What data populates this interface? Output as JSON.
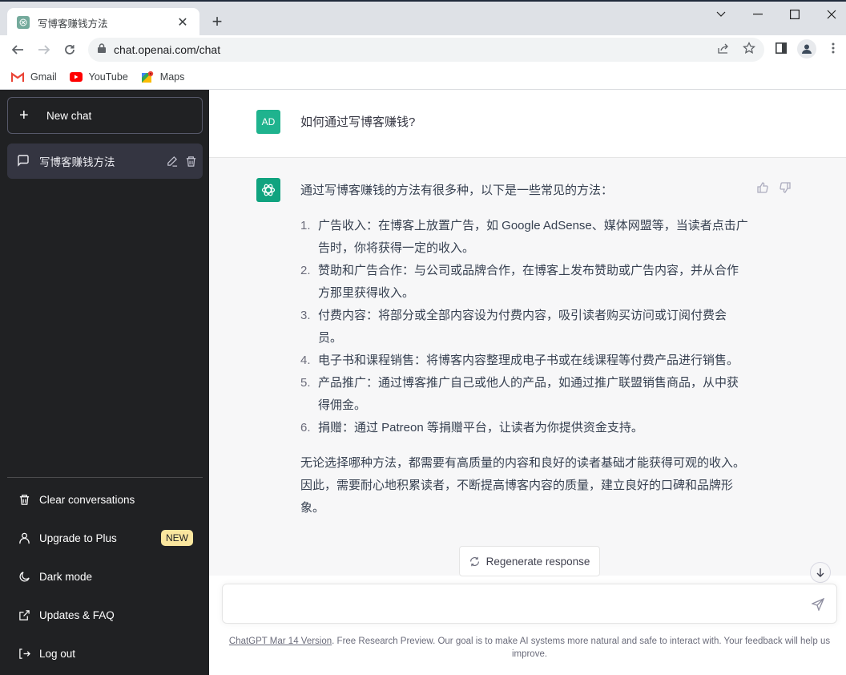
{
  "browser": {
    "tab_title": "写博客赚钱方法",
    "url": "chat.openai.com/chat",
    "bookmarks": [
      {
        "label": "Gmail",
        "icon": "gmail-icon"
      },
      {
        "label": "YouTube",
        "icon": "youtube-icon"
      },
      {
        "label": "Maps",
        "icon": "maps-icon"
      }
    ]
  },
  "sidebar": {
    "new_chat_label": "New chat",
    "conversation_title": "写博客赚钱方法",
    "items": [
      {
        "label": "Clear conversations",
        "icon": "trash-icon"
      },
      {
        "label": "Upgrade to Plus",
        "icon": "user-icon",
        "badge": "NEW"
      },
      {
        "label": "Dark mode",
        "icon": "moon-icon"
      },
      {
        "label": "Updates & FAQ",
        "icon": "external-link-icon"
      },
      {
        "label": "Log out",
        "icon": "logout-icon"
      }
    ]
  },
  "chat": {
    "user_avatar": "AD",
    "user_message": "如何通过写博客赚钱?",
    "bot_intro": "通过写博客赚钱的方法有很多种，以下是一些常见的方法：",
    "bot_list": [
      {
        "num": "1.",
        "text": "广告收入：在博客上放置广告，如 Google AdSense、媒体网盟等，当读者点击广告时，你将获得一定的收入。"
      },
      {
        "num": "2.",
        "text": "赞助和广告合作：与公司或品牌合作，在博客上发布赞助或广告内容，并从合作方那里获得收入。"
      },
      {
        "num": "3.",
        "text": "付费内容：将部分或全部内容设为付费内容，吸引读者购买访问或订阅付费会员。"
      },
      {
        "num": "4.",
        "text": "电子书和课程销售：将博客内容整理成电子书或在线课程等付费产品进行销售。"
      },
      {
        "num": "5.",
        "text": "产品推广：通过博客推广自己或他人的产品，如通过推广联盟销售商品，从中获得佣金。"
      },
      {
        "num": "6.",
        "text": "捐赠：通过 Patreon 等捐赠平台，让读者为你提供资金支持。"
      }
    ],
    "bot_conclusion": "无论选择哪种方法，都需要有高质量的内容和良好的读者基础才能获得可观的收入。因此，需要耐心地积累读者，不断提高博客内容的质量，建立良好的口碑和品牌形象。"
  },
  "composer": {
    "regenerate_label": "Regenerate response",
    "input_value": "",
    "footer_link": "ChatGPT Mar 14 Version",
    "footer_text": ". Free Research Preview. Our goal is to make AI systems more natural and safe to interact with. Your feedback will help us improve."
  },
  "colors": {
    "sidebar_bg": "#202123",
    "user_avatar_bg": "#1fb38e",
    "bot_avatar_bg": "#10a37f",
    "badge_bg": "#fae69e"
  }
}
